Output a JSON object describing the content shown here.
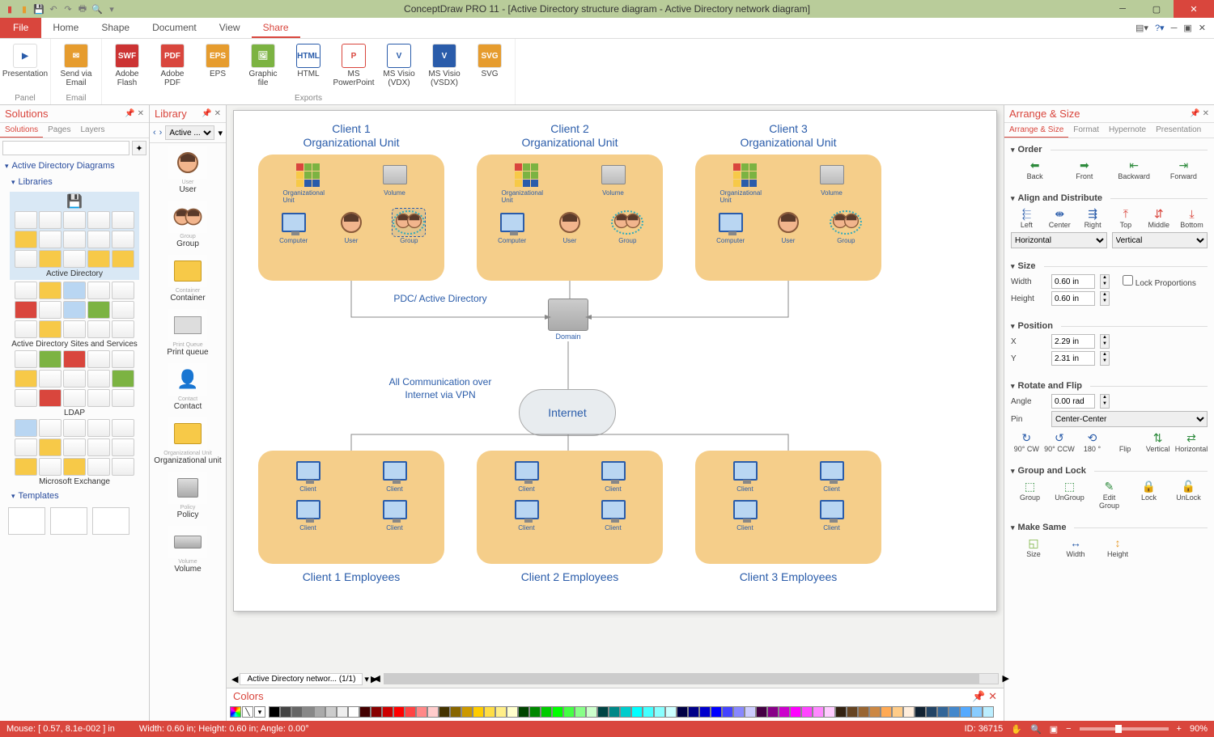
{
  "window": {
    "title": "ConceptDraw PRO 11 - [Active Directory structure diagram - Active Directory network diagram]"
  },
  "ribbon": {
    "tabs": {
      "file": "File",
      "home": "Home",
      "shape": "Shape",
      "document": "Document",
      "view": "View",
      "share": "Share"
    },
    "groups": {
      "panel": "Panel",
      "email": "Email",
      "exports": "Exports"
    },
    "buttons": {
      "presentation": "Presentation",
      "send_email": "Send via Email",
      "flash": "Adobe Flash",
      "pdf": "Adobe PDF",
      "eps": "EPS",
      "graphic": "Graphic file",
      "html": "HTML",
      "ppt": "MS PowerPoint",
      "vdx": "MS Visio (VDX)",
      "vsdx": "MS Visio (VSDX)",
      "svg": "SVG"
    }
  },
  "panels": {
    "solutions": {
      "title": "Solutions",
      "tabs": {
        "solutions": "Solutions",
        "pages": "Pages",
        "layers": "Layers"
      },
      "tree": {
        "root": "Active Directory Diagrams",
        "libraries": "Libraries",
        "templates": "Templates"
      },
      "items": [
        {
          "name": "Active Directory"
        },
        {
          "name": "Active Directory Sites and Services"
        },
        {
          "name": "LDAP"
        },
        {
          "name": "Microsoft Exchange"
        }
      ]
    },
    "library": {
      "title": "Library",
      "dropdown": "Active ...",
      "items": [
        {
          "label": "User",
          "sub": "User"
        },
        {
          "label": "Group",
          "sub": "Group"
        },
        {
          "label": "Container",
          "sub": "Container"
        },
        {
          "label": "Print queue",
          "sub": "Print Queue"
        },
        {
          "label": "Contact",
          "sub": "Contact"
        },
        {
          "label": "Organizational unit",
          "sub": "Organizational Unit"
        },
        {
          "label": "Policy",
          "sub": "Policy"
        },
        {
          "label": "Volume",
          "sub": "Volume"
        }
      ]
    },
    "arrange": {
      "title": "Arrange & Size",
      "tabs": {
        "arrange": "Arrange & Size",
        "format": "Format",
        "hypernote": "Hypernote",
        "presentation": "Presentation"
      },
      "sections": {
        "order": "Order",
        "align": "Align and Distribute",
        "size": "Size",
        "position": "Position",
        "rotate": "Rotate and Flip",
        "group": "Group and Lock",
        "makesame": "Make Same"
      },
      "order_btns": {
        "back": "Back",
        "front": "Front",
        "backward": "Backward",
        "forward": "Forward"
      },
      "align_btns": {
        "left": "Left",
        "center": "Center",
        "right": "Right",
        "top": "Top",
        "middle": "Middle",
        "bottom": "Bottom"
      },
      "align_sel": {
        "horizontal": "Horizontal",
        "vertical": "Vertical"
      },
      "size_fields": {
        "width_label": "Width",
        "width_val": "0.60 in",
        "height_label": "Height",
        "height_val": "0.60 in",
        "lock": "Lock Proportions"
      },
      "pos_fields": {
        "x_label": "X",
        "x_val": "2.29 in",
        "y_label": "Y",
        "y_val": "2.31 in"
      },
      "rotate_fields": {
        "angle_label": "Angle",
        "angle_val": "0.00 rad",
        "pin_label": "Pin",
        "pin_val": "Center-Center"
      },
      "rotate_btns": {
        "cw": "90° CW",
        "ccw": "90° CCW",
        "r180": "180 °",
        "flip": "Flip",
        "vert": "Vertical",
        "horiz": "Horizontal"
      },
      "group_btns": {
        "group": "Group",
        "ungroup": "UnGroup",
        "editgroup": "Edit Group",
        "lock": "Lock",
        "unlock": "UnLock"
      },
      "makesame_btns": {
        "size": "Size",
        "width": "Width",
        "height": "Height"
      }
    },
    "colors": {
      "title": "Colors"
    }
  },
  "canvas": {
    "page_tab": "Active Directory networ... (1/1)",
    "clients": [
      {
        "title1": "Client 1",
        "title2": "Organizational Unit",
        "footer": "Client 1 Employees"
      },
      {
        "title1": "Client 2",
        "title2": "Organizational Unit",
        "footer": "Client 2 Employees"
      },
      {
        "title1": "Client 3",
        "title2": "Organizational Unit",
        "footer": "Client 3 Employees"
      }
    ],
    "shapes": {
      "org_unit": "Organizational Unit",
      "volume": "Volume",
      "computer": "Computer",
      "user": "User",
      "group": "Group",
      "client": "Client"
    },
    "labels": {
      "pdc": "PDC/\nActive Directory",
      "vpn": "All Communication over\nInternet via VPN",
      "internet": "Internet",
      "domain": "Domain"
    }
  },
  "statusbar": {
    "mouse": "Mouse: [ 0.57, 8.1e-002 ] in",
    "size": "Width: 0.60 in;  Height: 0.60 in;  Angle: 0.00°",
    "id": "ID: 36715",
    "zoom": "90%"
  }
}
